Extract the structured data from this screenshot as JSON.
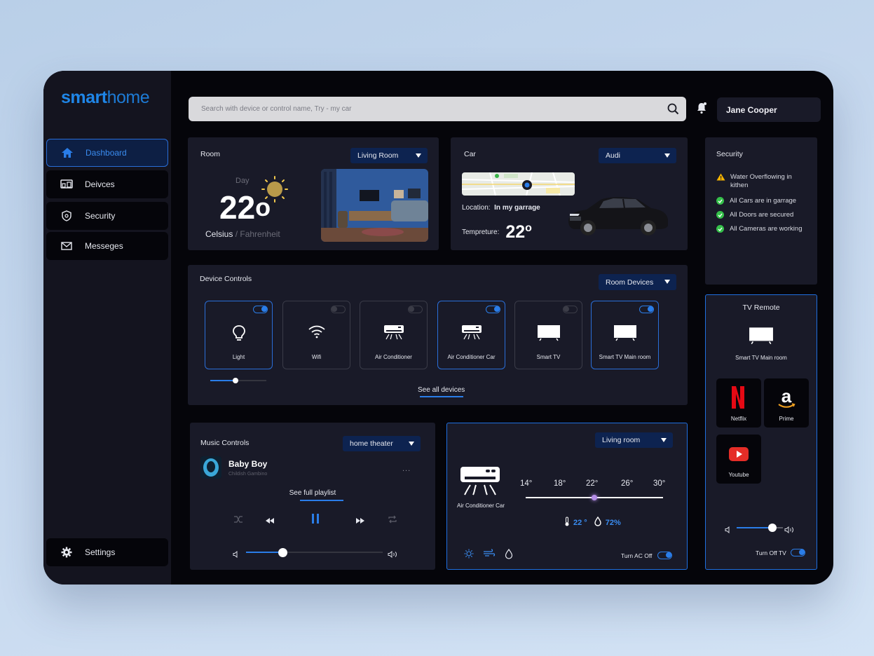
{
  "brand": {
    "part1": "smart",
    "part2": "home"
  },
  "sidebar": {
    "items": [
      {
        "label": "Dashboard",
        "icon": "home-icon"
      },
      {
        "label": "Deivces",
        "icon": "devices-icon"
      },
      {
        "label": "Security",
        "icon": "shield-icon"
      },
      {
        "label": "Messeges",
        "icon": "mail-icon"
      }
    ],
    "settings": {
      "label": "Settings",
      "icon": "gear-icon"
    }
  },
  "search": {
    "placeholder": "Search with device or control name, Try - my car"
  },
  "user": {
    "name": "Jane Cooper"
  },
  "room": {
    "title": "Room",
    "selected": "Living Room",
    "period": "Day",
    "temperature": "22",
    "degree": "o",
    "unit_active": "Celsius",
    "unit_sep": " / ",
    "unit_inactive": "Fahrenheit"
  },
  "car": {
    "title": "Car",
    "selected": "Audi",
    "location_label": "Location:",
    "location_value": "In my garrage",
    "temp_label": "Tempreture:",
    "temp_value": "22",
    "degree": "o"
  },
  "security": {
    "title": "Security",
    "alert": "Water Overflowing in kithen",
    "items": [
      "All Cars are in garrage",
      "All Doors are secured",
      "All Cameras are working"
    ]
  },
  "device_controls": {
    "title": "Device Controls",
    "selected": "Room Devices",
    "devices": [
      {
        "name": "Light",
        "on": true,
        "icon": "bulb-icon"
      },
      {
        "name": "Wifi",
        "on": false,
        "icon": "wifi-icon"
      },
      {
        "name": "Air Conditioner",
        "on": false,
        "icon": "ac-icon"
      },
      {
        "name": "Air Conditioner Car",
        "on": true,
        "icon": "ac-icon"
      },
      {
        "name": "Smart TV",
        "on": false,
        "icon": "tv-icon"
      },
      {
        "name": "Smart TV Main room",
        "on": true,
        "icon": "tv-icon"
      }
    ],
    "light_level": 0.45,
    "see_all": "See all devices"
  },
  "music": {
    "title": "Music Controls",
    "selected": "home theater",
    "song": "Baby Boy",
    "artist": "Childish Gambino",
    "more": "...",
    "playlist_link": "See full playlist",
    "volume": 0.27
  },
  "ac": {
    "selected": "Living room",
    "device_name": "Air Conditioner Car",
    "scale": [
      "14°",
      "18°",
      "22°",
      "26°",
      "30°"
    ],
    "set_value": 22,
    "temp_reading": "22 °",
    "humidity": "72%",
    "toggle_label": "Turn AC Off"
  },
  "tv_remote": {
    "title": "TV Remote",
    "device": "Smart TV Main room",
    "apps": [
      {
        "name": "Netflix",
        "icon": "netflix-icon"
      },
      {
        "name": "Prime",
        "icon": "amazon-icon"
      },
      {
        "name": "Youtube",
        "icon": "youtube-icon"
      }
    ],
    "volume": 0.78,
    "toggle_label": "Turn Off TV"
  },
  "colors": {
    "accent": "#2a7de8",
    "background": "#05050a",
    "card": "#191a28",
    "ok": "#35c04a",
    "warn": "#f6b400"
  }
}
